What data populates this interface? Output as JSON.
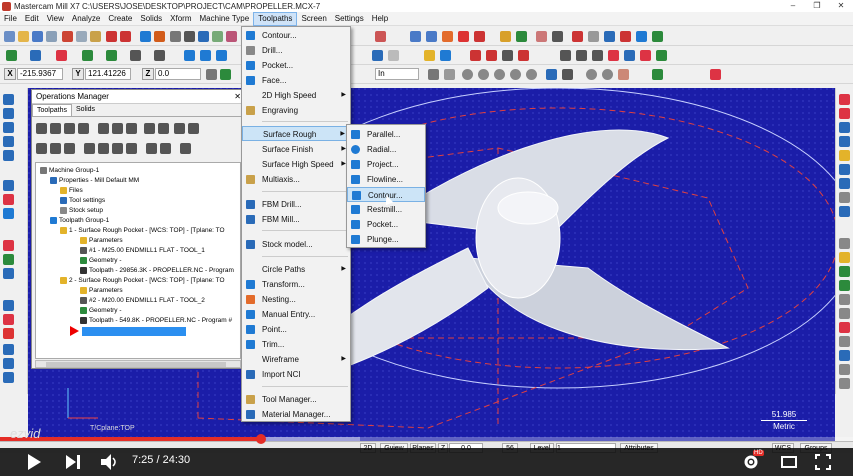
{
  "window": {
    "title": "Mastercam Mill X7  C:\\USERS\\JOSE\\DESKTOP\\PROJECT\\CAM\\PROPELLER.MCX-7",
    "controls": [
      "–",
      "❐",
      "✕"
    ]
  },
  "menubar": {
    "items": [
      "File",
      "Edit",
      "View",
      "Analyze",
      "Create",
      "Solids",
      "Xform",
      "Machine Type",
      "Toolpaths",
      "Screen",
      "Settings",
      "Help"
    ],
    "active": "Toolpaths"
  },
  "coords": {
    "x_label": "X",
    "x_value": "-215.9367",
    "y_label": "Y",
    "y_value": "121.41226",
    "z_label": "Z",
    "z_value": "0.0",
    "units_value": "In"
  },
  "ops_manager": {
    "title": "Operations Manager",
    "close": "✕",
    "tabs": [
      "Toolpaths",
      "Solids"
    ],
    "tree": [
      {
        "label": "Machine Group-1",
        "level": 0,
        "icon": "machine-group-icon"
      },
      {
        "label": "Properties - Mill Default MM",
        "level": 1,
        "icon": "properties-icon"
      },
      {
        "label": "Files",
        "level": 2,
        "icon": "folder-icon"
      },
      {
        "label": "Tool settings",
        "level": 2,
        "icon": "tool-settings-icon"
      },
      {
        "label": "Stock setup",
        "level": 2,
        "icon": "stock-setup-icon"
      },
      {
        "label": "Toolpath Group-1",
        "level": 1,
        "icon": "toolpath-group-icon"
      },
      {
        "label": "1 - Surface Rough Pocket - [WCS: TOP] - [Tplane: TO",
        "level": 2,
        "icon": "operation-folder-icon"
      },
      {
        "label": "Parameters",
        "level": 3,
        "icon": "parameters-icon"
      },
      {
        "label": "#1 - M25.00 ENDMILL1 FLAT - TOOL_1",
        "level": 3,
        "icon": "tool-icon"
      },
      {
        "label": "Geometry -",
        "level": 3,
        "icon": "geometry-icon"
      },
      {
        "label": "Toolpath - 29856.3K - PROPELLER.NC - Program",
        "level": 3,
        "icon": "toolpath-file-icon"
      },
      {
        "label": "2 - Surface Rough Pocket - [WCS: TOP] - [Tplane: TO",
        "level": 2,
        "icon": "operation-folder-icon"
      },
      {
        "label": "Parameters",
        "level": 3,
        "icon": "parameters-icon"
      },
      {
        "label": "#2 - M20.00 ENDMILL1 FLAT - TOOL_2",
        "level": 3,
        "icon": "tool-icon"
      },
      {
        "label": "Geometry -",
        "level": 3,
        "icon": "geometry-icon"
      },
      {
        "label": "Toolpath - 549.8K - PROPELLER.NC - Program #",
        "level": 3,
        "icon": "toolpath-file-icon"
      }
    ]
  },
  "toolpaths_menu": {
    "items": [
      {
        "label": "Contour...",
        "icon": "contour-icon",
        "sub": false
      },
      {
        "label": "Drill...",
        "icon": "drill-icon",
        "sub": false
      },
      {
        "label": "Pocket...",
        "icon": "pocket-icon",
        "sub": false
      },
      {
        "label": "Face...",
        "icon": "face-icon",
        "sub": false
      },
      {
        "label": "2D High Speed",
        "icon": "",
        "sub": true
      },
      {
        "label": "Engraving",
        "icon": "engraving-icon",
        "sub": false
      },
      {
        "label": "Surface Rough",
        "icon": "",
        "sub": true,
        "highlight": true
      },
      {
        "label": "Surface Finish",
        "icon": "",
        "sub": true
      },
      {
        "label": "Surface High Speed",
        "icon": "",
        "sub": true
      },
      {
        "label": "Multiaxis...",
        "icon": "multiaxis-icon",
        "sub": false
      },
      {
        "label": "FBM Drill...",
        "icon": "fbm-drill-icon",
        "sub": false
      },
      {
        "label": "FBM Mill...",
        "icon": "fbm-mill-icon",
        "sub": false
      },
      {
        "label": "Stock model...",
        "icon": "stock-model-icon",
        "sub": false
      },
      {
        "label": "Circle Paths",
        "icon": "",
        "sub": true
      },
      {
        "label": "Transform...",
        "icon": "transform-icon",
        "sub": false
      },
      {
        "label": "Nesting...",
        "icon": "nesting-icon",
        "sub": false
      },
      {
        "label": "Manual Entry...",
        "icon": "manual-entry-icon",
        "sub": false
      },
      {
        "label": "Point...",
        "icon": "point-icon",
        "sub": false
      },
      {
        "label": "Trim...",
        "icon": "trim-icon",
        "sub": false
      },
      {
        "label": "Wireframe",
        "icon": "",
        "sub": true
      },
      {
        "label": "Import NCI",
        "icon": "import-nci-icon",
        "sub": false
      },
      {
        "label": "Tool Manager...",
        "icon": "tool-manager-icon",
        "sub": false
      },
      {
        "label": "Material Manager...",
        "icon": "material-manager-icon",
        "sub": false
      }
    ]
  },
  "surface_rough_submenu": {
    "items": [
      {
        "label": "Parallel...",
        "icon": "parallel-icon"
      },
      {
        "label": "Radial...",
        "icon": "radial-icon"
      },
      {
        "label": "Project...",
        "icon": "project-icon"
      },
      {
        "label": "Flowline...",
        "icon": "flowline-icon"
      },
      {
        "label": "Contour...",
        "icon": "contour-rough-icon",
        "highlight": true
      },
      {
        "label": "Restmill...",
        "icon": "restmill-icon"
      },
      {
        "label": "Pocket...",
        "icon": "pocket-rough-icon"
      },
      {
        "label": "Plunge...",
        "icon": "plunge-icon"
      }
    ]
  },
  "viewport": {
    "scale_value": "51.985",
    "scale_unit": "Metric",
    "cplane_text": "T/Cplane:TOP"
  },
  "statusbar": {
    "mode": "2D",
    "gview": "Gview",
    "planes": "Planes",
    "z_label": "Z",
    "z_value": "0.0",
    "color_num": "56",
    "level_label": "Level",
    "level_value": "1",
    "attributes": "Attributes",
    "wcs": "WCS",
    "groups": "Groups"
  },
  "player": {
    "time": "7:25 / 24:30",
    "watermark": "ezvid",
    "hd": "HD"
  },
  "colors": {
    "viewport_bg": "#1b1da8",
    "menu_highlight": "#cce4f7",
    "progress_red": "#e52d27"
  }
}
